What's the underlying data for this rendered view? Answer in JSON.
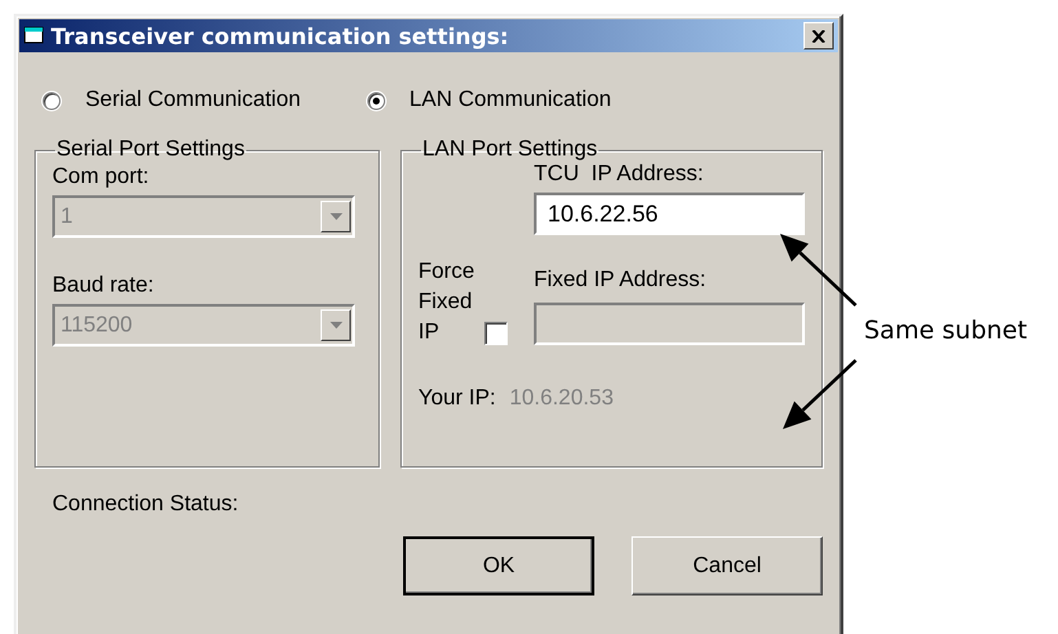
{
  "window": {
    "title": "Transceiver communication settings:"
  },
  "connection_modes": [
    {
      "label": "Serial Communication",
      "selected": false
    },
    {
      "label": "LAN Communication",
      "selected": true
    }
  ],
  "serial_port_settings": {
    "title": "Serial Port Settings",
    "fields": [
      {
        "label": "Com port:",
        "value": "1",
        "disabled": true
      },
      {
        "label": "Baud rate:",
        "value": "115200",
        "disabled": true
      }
    ]
  },
  "lan_port_settings": {
    "title": "LAN Port Settings",
    "tcu_ip": {
      "label": "TCU  IP Address:",
      "value": "10.6.22.56"
    },
    "force_fixed_ip": {
      "label": "Force Fixed IP",
      "checked": false
    },
    "fixed_ip": {
      "label": "Fixed IP Address:",
      "disabled": true
    },
    "your_ip": {
      "label": "Your IP:",
      "value": "10.6.20.53"
    }
  },
  "connection_status": {
    "label": "Connection Status:"
  },
  "buttons": [
    {
      "label": "OK",
      "default": true
    },
    {
      "label": "Cancel",
      "default": false
    }
  ],
  "annotation": {
    "text": "Same subnet"
  }
}
